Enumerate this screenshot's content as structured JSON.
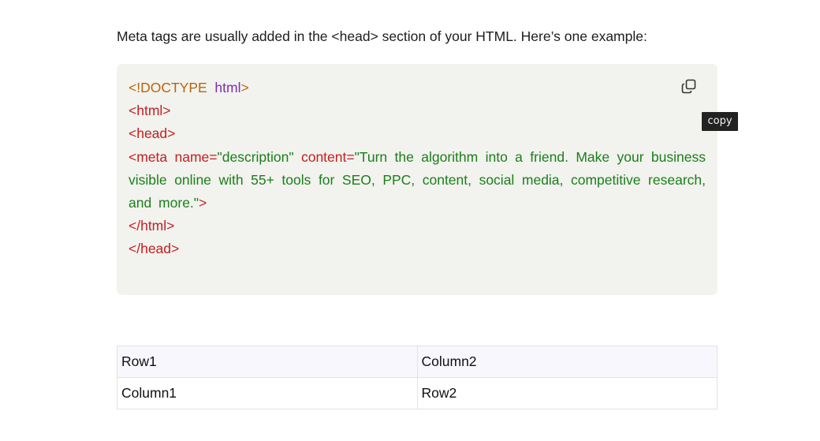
{
  "intro_text": "Meta tags are usually added in the <head> section of your HTML. Here’s one example:",
  "code": {
    "doctype_open": "<!DOCTYPE",
    "doctype_keyword": "html",
    "doctype_close": ">",
    "html_open": "<html>",
    "head_open": "<head>",
    "meta_open": "<meta",
    "meta_name_attr": "name=",
    "meta_name_value": "\"description\"",
    "meta_content_attr": "content=",
    "meta_content_value": "\"Turn the algorithm into a friend. Make your business visible online with 55+ tools for SEO, PPC, content, social media, competitive research, and more.\"",
    "meta_close": ">",
    "html_close": "</html>",
    "head_close": "</head>"
  },
  "copy_button": {
    "icon": "copy-icon",
    "tooltip": "copy"
  },
  "table": {
    "rows": [
      [
        "Row1",
        "Column2"
      ],
      [
        "Column1",
        "Row2"
      ]
    ]
  },
  "colors": {
    "code_background": "#f2f2ee",
    "tag": "#c41e1e",
    "doctype": "#b8660c",
    "keyword": "#7c2fb0",
    "string": "#1a7f1a",
    "tooltip_background": "#222222"
  }
}
